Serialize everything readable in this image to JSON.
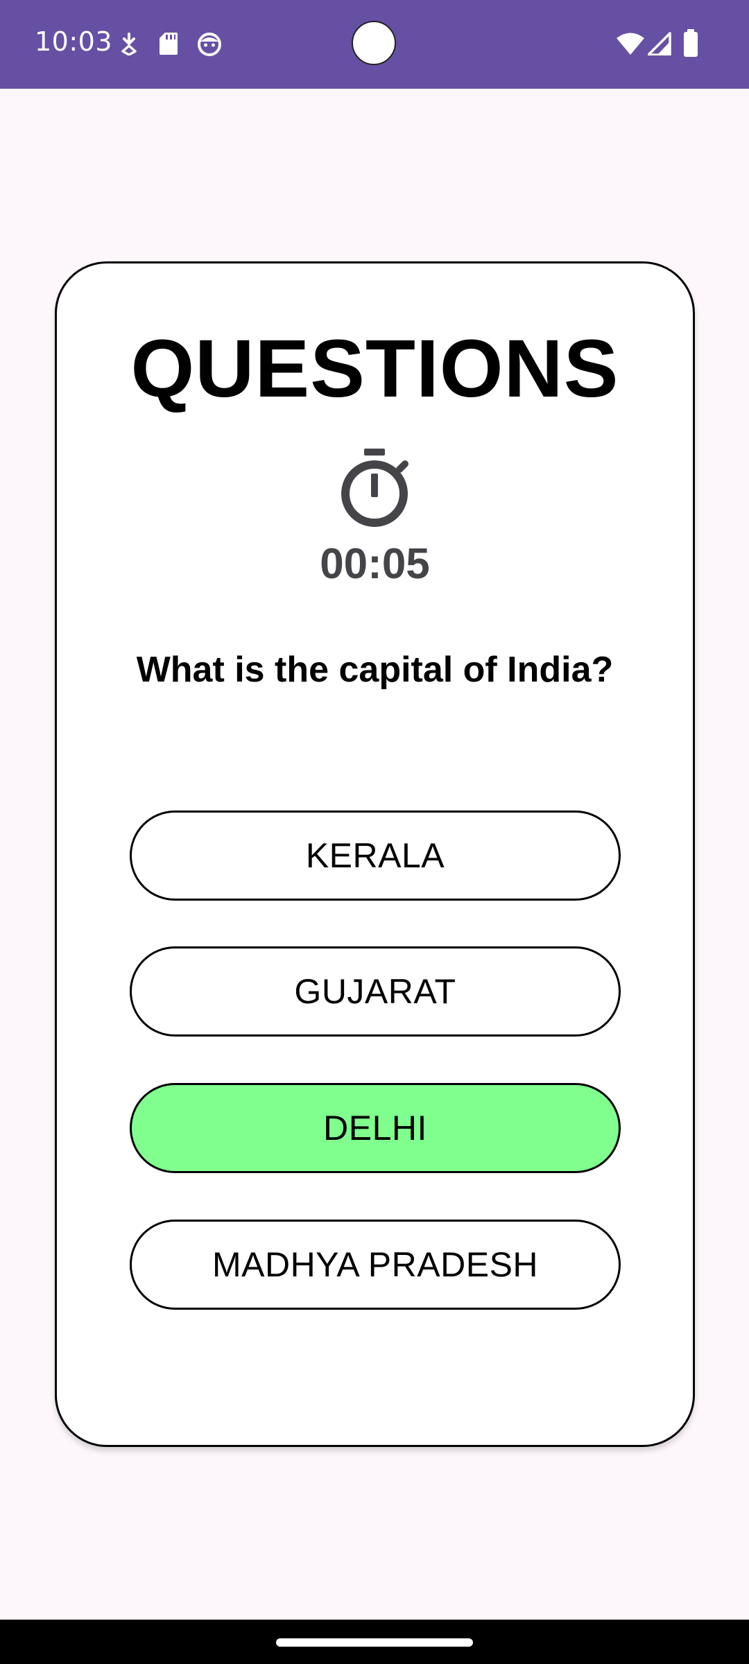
{
  "status_bar": {
    "time": "10:03",
    "background_color": "#6650a4",
    "left_icons": [
      "download-notification-icon",
      "sd-card-icon",
      "face-icon"
    ],
    "right_icons": [
      "wifi-icon",
      "cellular-signal-icon",
      "battery-icon"
    ]
  },
  "quiz": {
    "title": "QUESTIONS",
    "timer_icon": "stopwatch-icon",
    "timer": "00:05",
    "question": "What is the capital of India?",
    "options": [
      {
        "label": "KERALA",
        "state": "default"
      },
      {
        "label": "GUJARAT",
        "state": "default"
      },
      {
        "label": "DELHI",
        "state": "correct"
      },
      {
        "label": "MADHYA PRADESH",
        "state": "default"
      }
    ],
    "correct_color": "#80ff8e"
  }
}
